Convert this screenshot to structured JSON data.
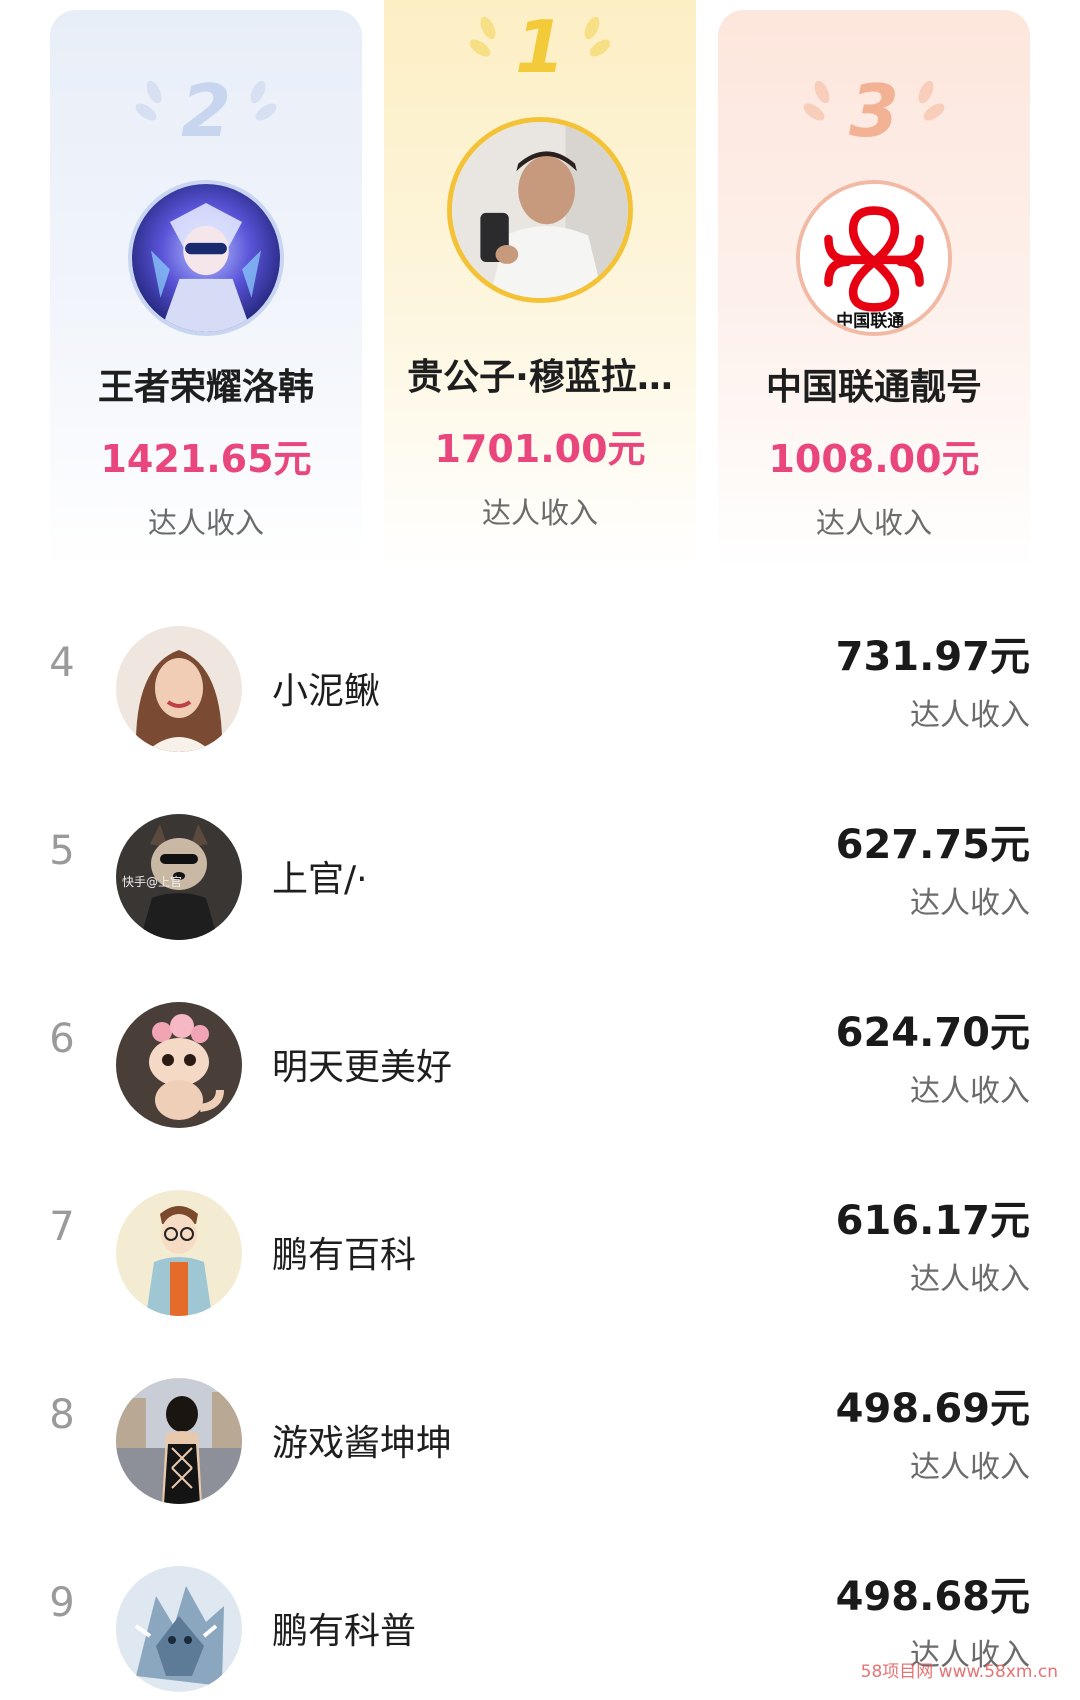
{
  "podium": [
    {
      "rank": "2",
      "name": "王者荣耀洛韩",
      "amount": "1421.65元",
      "label": "达人收入",
      "color": "#c9d6f2",
      "avatar": "game-character-avatar"
    },
    {
      "rank": "1",
      "name": "贵公子·穆蓝拉…",
      "amount": "1701.00元",
      "label": "达人收入",
      "color": "#f3c236",
      "avatar": "man-selfie-avatar"
    },
    {
      "rank": "3",
      "name": "中国联通靓号",
      "amount": "1008.00元",
      "label": "达人收入",
      "color": "#f2b9a4",
      "avatar": "china-unicom-logo",
      "logo_text": "中国联通"
    }
  ],
  "list": [
    {
      "rank": "4",
      "name": "小泥鳅",
      "amount": "731.97元",
      "label": "达人收入",
      "avatar": "woman-portrait-avatar"
    },
    {
      "rank": "5",
      "name": "上官/·",
      "amount": "627.75元",
      "label": "达人收入",
      "avatar": "dog-in-suit-avatar",
      "avatar_text": "快手@上官"
    },
    {
      "rank": "6",
      "name": "明天更美好",
      "amount": "624.70元",
      "label": "达人收入",
      "avatar": "cute-dragon-avatar"
    },
    {
      "rank": "7",
      "name": "鹏有百科",
      "amount": "616.17元",
      "label": "达人收入",
      "avatar": "cartoon-boy-avatar"
    },
    {
      "rank": "8",
      "name": "游戏酱坤坤",
      "amount": "498.69元",
      "label": "达人收入",
      "avatar": "woman-back-avatar"
    },
    {
      "rank": "9",
      "name": "鹏有科普",
      "amount": "498.68元",
      "label": "达人收入",
      "avatar": "ice-wolf-avatar"
    }
  ],
  "watermark": "58项目网 www.58xm.cn",
  "colors": {
    "amount_pink": "#e8467d",
    "gold": "#f3c236",
    "silver": "#c9d6f2",
    "bronze": "#f2b9a4"
  }
}
